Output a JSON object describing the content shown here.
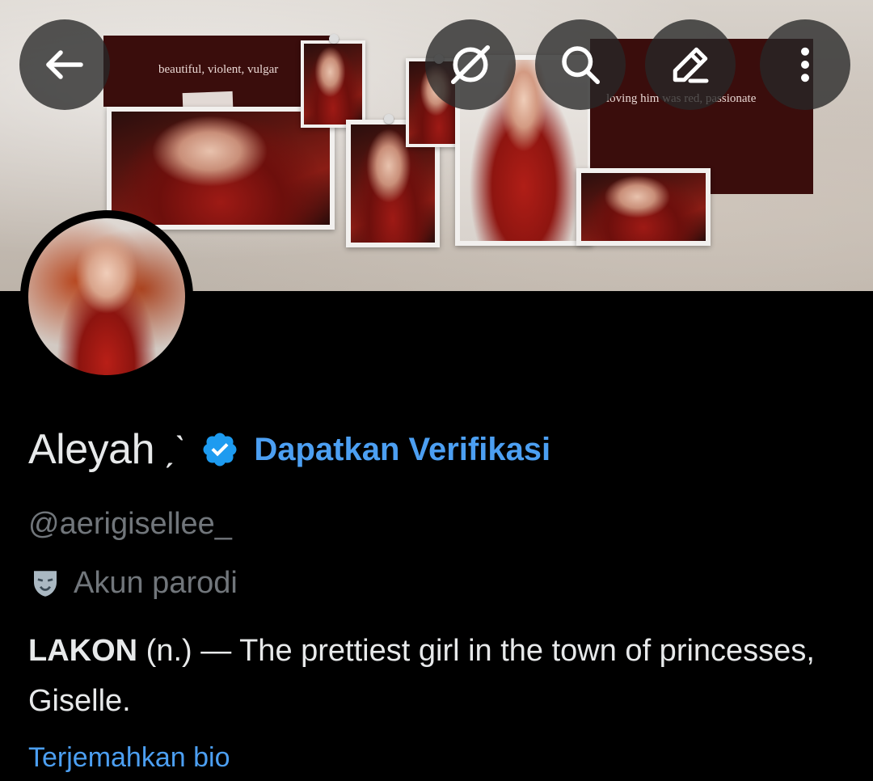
{
  "banner": {
    "caption_left": "beautiful, violent, vulgar",
    "caption_right": "loving him was red, passionate"
  },
  "nav": {
    "back_icon": "arrow-left-icon",
    "grok_icon": "grok-slash-icon",
    "search_icon": "search-icon",
    "edit_icon": "pencil-icon",
    "more_icon": "more-vertical-icon"
  },
  "profile": {
    "display_name": "Aleyah",
    "name_suffix": "ˏˋ",
    "verify_cta": "Dapatkan Verifikasi",
    "handle": "@aerigisellee_",
    "parody_label": "Akun parodi",
    "bio_term": "LAKON",
    "bio_rest": " (n.) — The prettiest girl in the town of princesses, Giselle.",
    "translate_link": "Terjemahkan bio"
  },
  "colors": {
    "background": "#000000",
    "primary_text": "#e7e9ea",
    "secondary_text": "#71767b",
    "link_blue": "#4c9ff2",
    "verified_blue": "#1d9bf0"
  }
}
